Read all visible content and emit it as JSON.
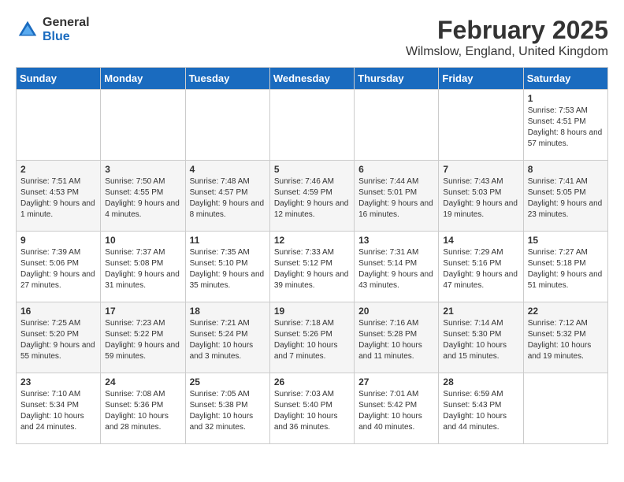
{
  "logo": {
    "general": "General",
    "blue": "Blue"
  },
  "title": "February 2025",
  "subtitle": "Wilmslow, England, United Kingdom",
  "days_of_week": [
    "Sunday",
    "Monday",
    "Tuesday",
    "Wednesday",
    "Thursday",
    "Friday",
    "Saturday"
  ],
  "weeks": [
    [
      {
        "day": "",
        "info": ""
      },
      {
        "day": "",
        "info": ""
      },
      {
        "day": "",
        "info": ""
      },
      {
        "day": "",
        "info": ""
      },
      {
        "day": "",
        "info": ""
      },
      {
        "day": "",
        "info": ""
      },
      {
        "day": "1",
        "info": "Sunrise: 7:53 AM\nSunset: 4:51 PM\nDaylight: 8 hours and 57 minutes."
      }
    ],
    [
      {
        "day": "2",
        "info": "Sunrise: 7:51 AM\nSunset: 4:53 PM\nDaylight: 9 hours and 1 minute."
      },
      {
        "day": "3",
        "info": "Sunrise: 7:50 AM\nSunset: 4:55 PM\nDaylight: 9 hours and 4 minutes."
      },
      {
        "day": "4",
        "info": "Sunrise: 7:48 AM\nSunset: 4:57 PM\nDaylight: 9 hours and 8 minutes."
      },
      {
        "day": "5",
        "info": "Sunrise: 7:46 AM\nSunset: 4:59 PM\nDaylight: 9 hours and 12 minutes."
      },
      {
        "day": "6",
        "info": "Sunrise: 7:44 AM\nSunset: 5:01 PM\nDaylight: 9 hours and 16 minutes."
      },
      {
        "day": "7",
        "info": "Sunrise: 7:43 AM\nSunset: 5:03 PM\nDaylight: 9 hours and 19 minutes."
      },
      {
        "day": "8",
        "info": "Sunrise: 7:41 AM\nSunset: 5:05 PM\nDaylight: 9 hours and 23 minutes."
      }
    ],
    [
      {
        "day": "9",
        "info": "Sunrise: 7:39 AM\nSunset: 5:06 PM\nDaylight: 9 hours and 27 minutes."
      },
      {
        "day": "10",
        "info": "Sunrise: 7:37 AM\nSunset: 5:08 PM\nDaylight: 9 hours and 31 minutes."
      },
      {
        "day": "11",
        "info": "Sunrise: 7:35 AM\nSunset: 5:10 PM\nDaylight: 9 hours and 35 minutes."
      },
      {
        "day": "12",
        "info": "Sunrise: 7:33 AM\nSunset: 5:12 PM\nDaylight: 9 hours and 39 minutes."
      },
      {
        "day": "13",
        "info": "Sunrise: 7:31 AM\nSunset: 5:14 PM\nDaylight: 9 hours and 43 minutes."
      },
      {
        "day": "14",
        "info": "Sunrise: 7:29 AM\nSunset: 5:16 PM\nDaylight: 9 hours and 47 minutes."
      },
      {
        "day": "15",
        "info": "Sunrise: 7:27 AM\nSunset: 5:18 PM\nDaylight: 9 hours and 51 minutes."
      }
    ],
    [
      {
        "day": "16",
        "info": "Sunrise: 7:25 AM\nSunset: 5:20 PM\nDaylight: 9 hours and 55 minutes."
      },
      {
        "day": "17",
        "info": "Sunrise: 7:23 AM\nSunset: 5:22 PM\nDaylight: 9 hours and 59 minutes."
      },
      {
        "day": "18",
        "info": "Sunrise: 7:21 AM\nSunset: 5:24 PM\nDaylight: 10 hours and 3 minutes."
      },
      {
        "day": "19",
        "info": "Sunrise: 7:18 AM\nSunset: 5:26 PM\nDaylight: 10 hours and 7 minutes."
      },
      {
        "day": "20",
        "info": "Sunrise: 7:16 AM\nSunset: 5:28 PM\nDaylight: 10 hours and 11 minutes."
      },
      {
        "day": "21",
        "info": "Sunrise: 7:14 AM\nSunset: 5:30 PM\nDaylight: 10 hours and 15 minutes."
      },
      {
        "day": "22",
        "info": "Sunrise: 7:12 AM\nSunset: 5:32 PM\nDaylight: 10 hours and 19 minutes."
      }
    ],
    [
      {
        "day": "23",
        "info": "Sunrise: 7:10 AM\nSunset: 5:34 PM\nDaylight: 10 hours and 24 minutes."
      },
      {
        "day": "24",
        "info": "Sunrise: 7:08 AM\nSunset: 5:36 PM\nDaylight: 10 hours and 28 minutes."
      },
      {
        "day": "25",
        "info": "Sunrise: 7:05 AM\nSunset: 5:38 PM\nDaylight: 10 hours and 32 minutes."
      },
      {
        "day": "26",
        "info": "Sunrise: 7:03 AM\nSunset: 5:40 PM\nDaylight: 10 hours and 36 minutes."
      },
      {
        "day": "27",
        "info": "Sunrise: 7:01 AM\nSunset: 5:42 PM\nDaylight: 10 hours and 40 minutes."
      },
      {
        "day": "28",
        "info": "Sunrise: 6:59 AM\nSunset: 5:43 PM\nDaylight: 10 hours and 44 minutes."
      },
      {
        "day": "",
        "info": ""
      }
    ]
  ]
}
